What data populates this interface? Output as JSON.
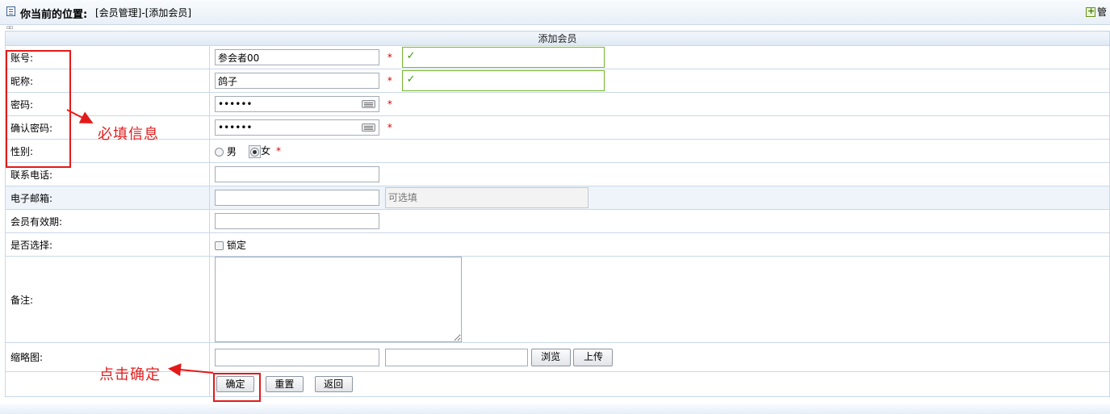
{
  "topbar": {
    "location_label": "你当前的位置:",
    "location_path": "[会员管理]-[添加会员]",
    "manage_label": "管"
  },
  "tiny_mark": "▫▫",
  "form": {
    "title": "添加会员",
    "account": {
      "label": "账号:",
      "value": "参会者00",
      "required": "*",
      "valid_mark": "✓"
    },
    "nickname": {
      "label": "昵称:",
      "value": "鸽子",
      "required": "*",
      "valid_mark": "✓"
    },
    "password": {
      "label": "密码:",
      "value": "••••••",
      "required": "*"
    },
    "confirm_password": {
      "label": "确认密码:",
      "value": "••••••",
      "required": "*"
    },
    "gender": {
      "label": "性别:",
      "male": "男",
      "female": "女",
      "selected": "女",
      "required": "*"
    },
    "phone": {
      "label": "联系电话:",
      "value": ""
    },
    "email": {
      "label": "电子邮箱:",
      "value": "",
      "optional_placeholder": "可选填"
    },
    "validity": {
      "label": "会员有效期:",
      "value": ""
    },
    "select": {
      "label": "是否选择:",
      "checkbox_label": "锁定",
      "checked": false
    },
    "notes": {
      "label": "备注:",
      "value": ""
    },
    "thumbnail": {
      "label": "缩略图:",
      "path_value": "",
      "file_value": "",
      "browse": "浏览",
      "upload": "上传"
    },
    "buttons": {
      "confirm": "确定",
      "reset": "重置",
      "back": "返回"
    }
  },
  "annotations": {
    "required_info": "必填信息",
    "click_confirm": "点击确定",
    "color": "#e31a1a"
  }
}
